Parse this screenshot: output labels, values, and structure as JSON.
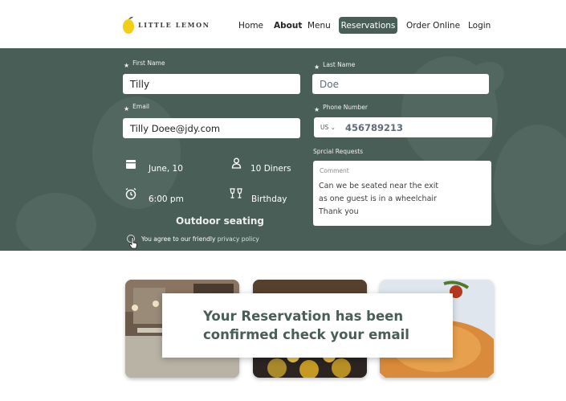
{
  "brand": {
    "name": "LITTLE LEMON"
  },
  "nav": {
    "home": "Home",
    "about": "About",
    "menu": "Menu",
    "reservations": "Reservations",
    "order_online": "Order Online",
    "login": "Login"
  },
  "form": {
    "first_name": {
      "label": "First Name",
      "value": "Tilly"
    },
    "last_name": {
      "label": "Last Name",
      "value": "Doe"
    },
    "email": {
      "label": "Email",
      "value": "Tilly Doee@jdy.com"
    },
    "phone": {
      "label": "Phone Number",
      "country": "US",
      "value": "456789213"
    },
    "date": "June, 10",
    "diners": "10 Diners",
    "time": "6:00 pm",
    "occasion": "Birthday",
    "seating": "Outdoor seating",
    "special_requests": {
      "label": "Sprcial Requests",
      "placeholder": "Comment",
      "value": "Can we be seated near the exit\nas one guest is in a wheelchair\nThank you"
    },
    "agree_text": "You agree to our friendly",
    "agree_link": "privacy policy"
  },
  "confirmation": {
    "message": "Your  Reservation has been\nconfirmed check your email"
  },
  "colors": {
    "primary": "#495e57",
    "accent": "#f4ce14"
  }
}
